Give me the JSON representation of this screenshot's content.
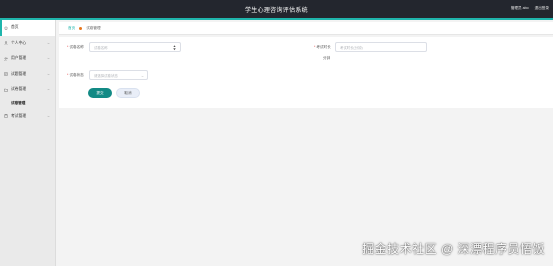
{
  "app": {
    "title": "学生心理咨询评估系统",
    "user_label": "管理员 abo",
    "logout_label": "退出登录"
  },
  "colors": {
    "header_bg": "#23262e",
    "accent": "#1fb5ac",
    "primary_button": "#128a85",
    "breadcrumb_dot": "#e8761c",
    "required_mark": "#e23c3c"
  },
  "sidebar": {
    "items": [
      {
        "label": "首页",
        "icon": "home-icon"
      },
      {
        "label": "个人中心",
        "icon": "user-icon"
      },
      {
        "label": "用户管理",
        "icon": "users-icon"
      },
      {
        "label": "试题管理",
        "icon": "document-icon"
      },
      {
        "label": "试卷管理",
        "icon": "folder-icon"
      },
      {
        "label": "考试管理",
        "icon": "clipboard-icon"
      }
    ],
    "subitem": "试卷管理"
  },
  "breadcrumb": {
    "home": "首页",
    "current": "试卷管理"
  },
  "form": {
    "name_label": "试卷名称",
    "name_placeholder": "试卷名称",
    "duration_label": "考试时长",
    "duration_placeholder": "考试时长(分钟)",
    "duration_unit": "分钟",
    "status_label": "试卷状态",
    "status_placeholder": "请选择试卷状态",
    "submit": "提交",
    "cancel": "取消"
  },
  "watermark": "掘金技术社区 @ 深漂程序员悟饭"
}
